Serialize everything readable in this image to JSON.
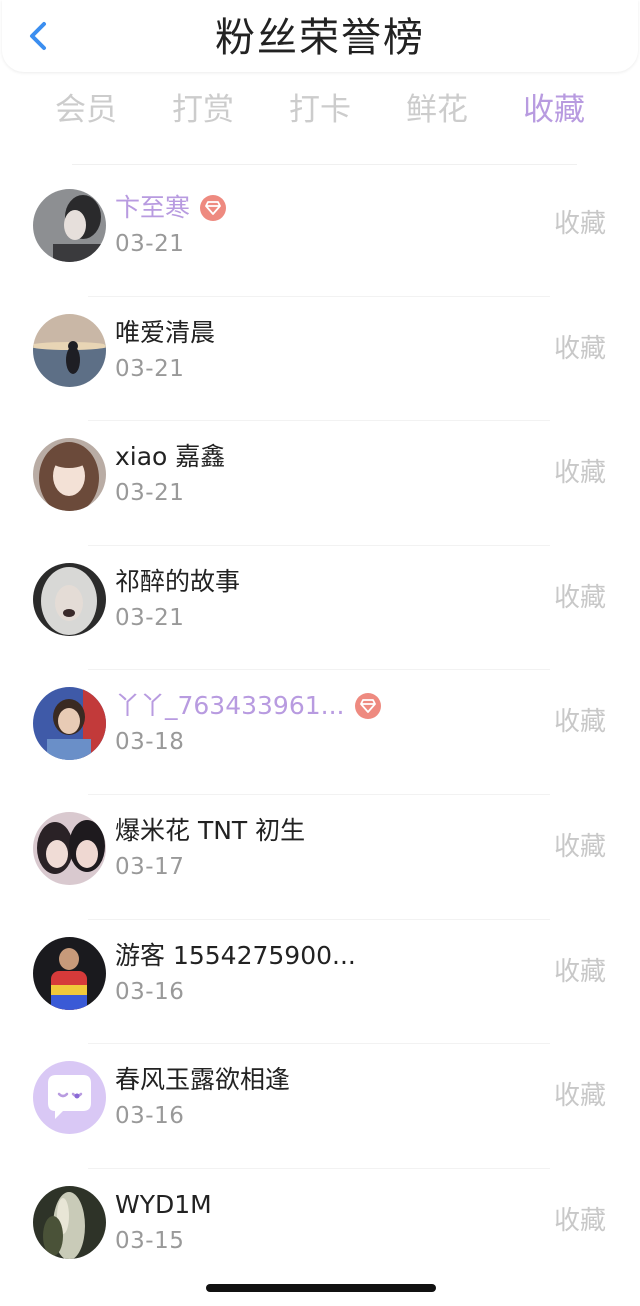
{
  "header": {
    "title": "粉丝荣誉榜",
    "back_icon": "chevron-left-icon",
    "accent_color": "#3b8ef0"
  },
  "tabs": [
    {
      "label": "会员",
      "active": false
    },
    {
      "label": "打赏",
      "active": false
    },
    {
      "label": "打卡",
      "active": false
    },
    {
      "label": "鲜花",
      "active": false
    },
    {
      "label": "收藏",
      "active": true
    }
  ],
  "colors": {
    "active_tab": "#b89be0",
    "vip_name": "#b89be0",
    "vip_badge": "#ee8a80",
    "muted": "#c8c8c8"
  },
  "fans": [
    {
      "name": "卞至寒",
      "date": "03-21",
      "action": "收藏",
      "vip": true
    },
    {
      "name": "唯爱清晨",
      "date": "03-21",
      "action": "收藏",
      "vip": false
    },
    {
      "name": "xiao 嘉鑫",
      "date": "03-21",
      "action": "收藏",
      "vip": false
    },
    {
      "name": "祁醉的故事",
      "date": "03-21",
      "action": "收藏",
      "vip": false
    },
    {
      "name": "丫丫_763433961...",
      "date": "03-18",
      "action": "收藏",
      "vip": true
    },
    {
      "name": "爆米花 TNT 初生",
      "date": "03-17",
      "action": "收藏",
      "vip": false
    },
    {
      "name": "游客 1554275900...",
      "date": "03-16",
      "action": "收藏",
      "vip": false
    },
    {
      "name": "春风玉露欲相逢",
      "date": "03-16",
      "action": "收藏",
      "vip": false
    },
    {
      "name": "WYD1M",
      "date": "03-15",
      "action": "收藏",
      "vip": false
    }
  ]
}
